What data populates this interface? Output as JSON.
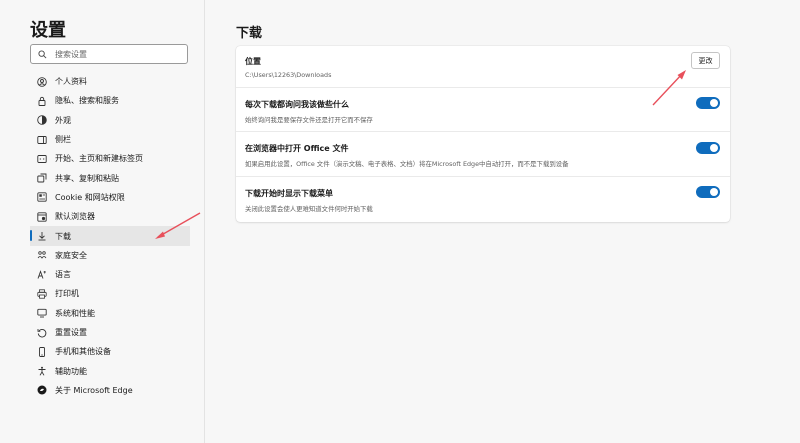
{
  "sidebar": {
    "title": "设置",
    "search_placeholder": "搜索设置",
    "items": [
      {
        "label": "个人资料",
        "icon": "profile-icon"
      },
      {
        "label": "隐私、搜索和服务",
        "icon": "lock-icon"
      },
      {
        "label": "外观",
        "icon": "appearance-icon"
      },
      {
        "label": "侧栏",
        "icon": "sidebar-icon"
      },
      {
        "label": "开始、主页和新建标签页",
        "icon": "home-icon"
      },
      {
        "label": "共享、复制和粘贴",
        "icon": "share-icon"
      },
      {
        "label": "Cookie 和网站权限",
        "icon": "cookie-icon"
      },
      {
        "label": "默认浏览器",
        "icon": "browser-icon"
      },
      {
        "label": "下载",
        "icon": "download-icon"
      },
      {
        "label": "家庭安全",
        "icon": "family-icon"
      },
      {
        "label": "语言",
        "icon": "language-icon"
      },
      {
        "label": "打印机",
        "icon": "printer-icon"
      },
      {
        "label": "系统和性能",
        "icon": "system-icon"
      },
      {
        "label": "重置设置",
        "icon": "reset-icon"
      },
      {
        "label": "手机和其他设备",
        "icon": "phone-icon"
      },
      {
        "label": "辅助功能",
        "icon": "accessibility-icon"
      },
      {
        "label": "关于 Microsoft Edge",
        "icon": "edge-icon"
      }
    ],
    "active_index": 8
  },
  "main": {
    "title": "下载",
    "location": {
      "title": "位置",
      "path": "C:\\Users\\12263\\Downloads",
      "button_label": "更改"
    },
    "settings": [
      {
        "title": "每次下载都询问我该做些什么",
        "desc": "始终询问我是要保存文件还是打开它而不保存",
        "enabled": true
      },
      {
        "title": "在浏览器中打开 Office 文件",
        "desc": "如果启用此设置，Office 文件（演示文稿、电子表格、文档）将在Microsoft Edge中自动打开，而不是下载到设备",
        "enabled": true
      },
      {
        "title": "下载开始时显示下载菜单",
        "desc": "关闭此设置会使人更难知道文件何时开始下载",
        "enabled": true
      }
    ]
  },
  "colors": {
    "accent": "#0f6cbd",
    "annotation_arrow": "#e8505b"
  }
}
